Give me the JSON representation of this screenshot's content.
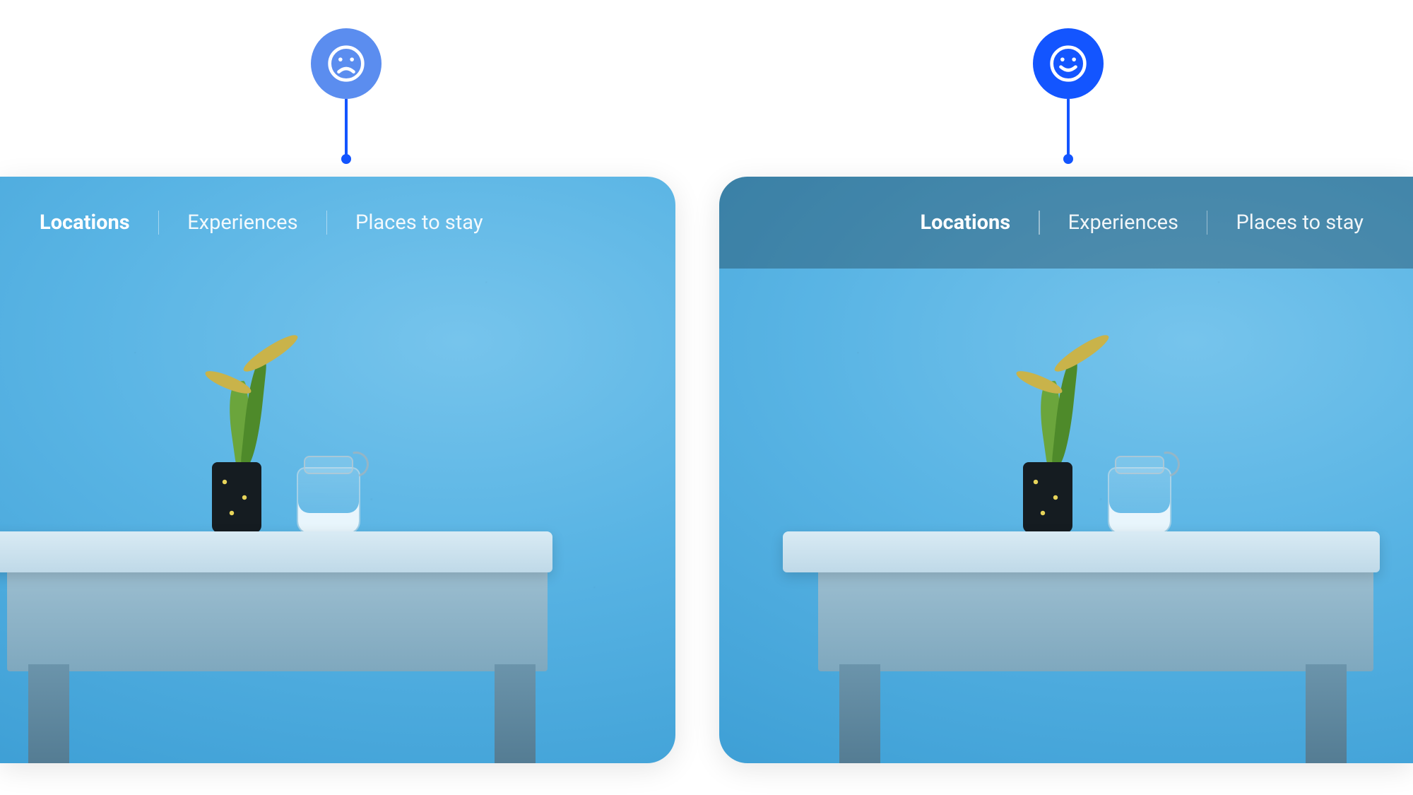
{
  "nav": {
    "items": [
      "Locations",
      "Experiences",
      "Places to stay"
    ],
    "active_index": 0
  },
  "indicators": {
    "left": {
      "mood": "sad",
      "icon": "sad-face-icon"
    },
    "right": {
      "mood": "happy",
      "icon": "happy-face-icon"
    }
  },
  "colors": {
    "accent_light": "#5B8DEF",
    "accent": "#1355FF",
    "nav_overlay": "rgba(20,45,60,.35)"
  }
}
